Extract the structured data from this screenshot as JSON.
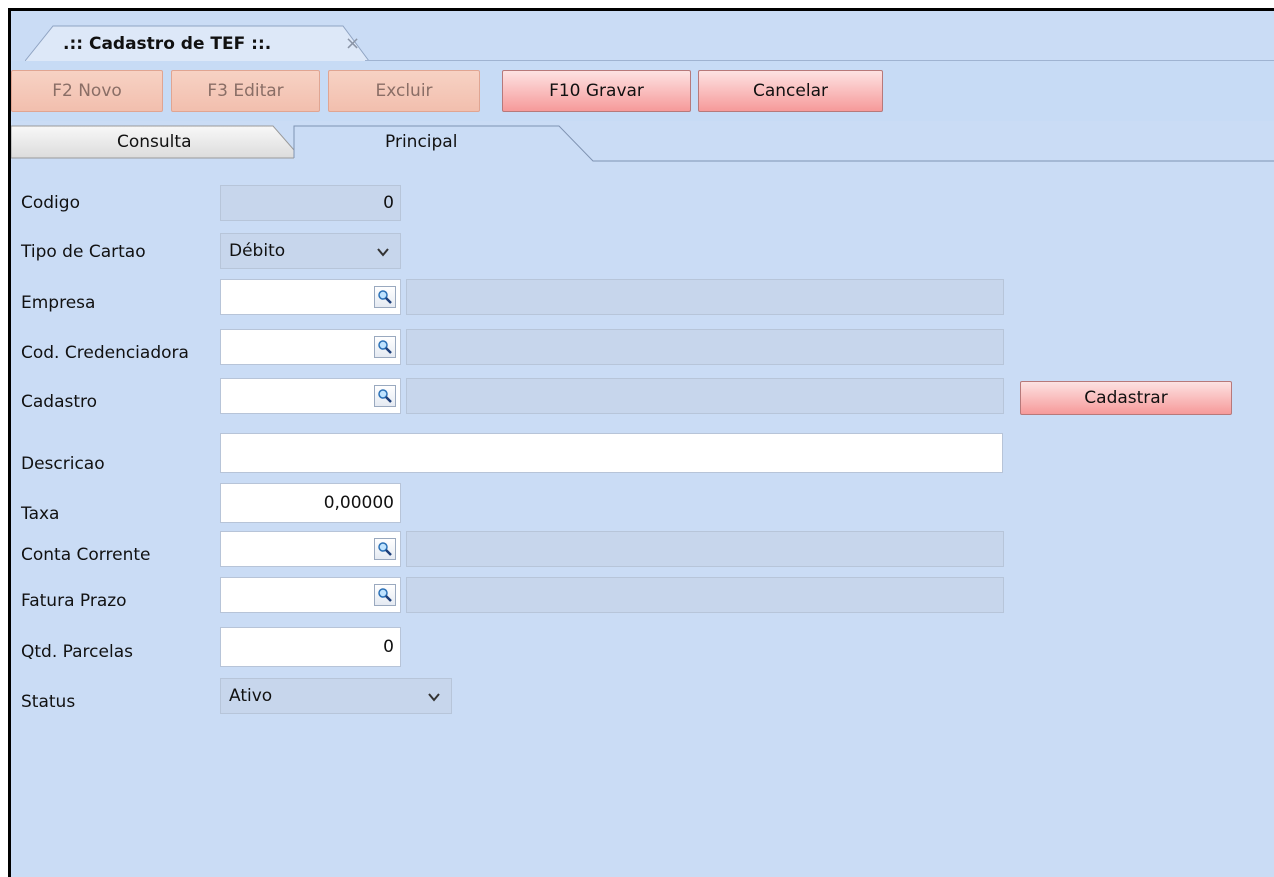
{
  "window": {
    "tab_title": ".:: Cadastro de TEF ::.",
    "close_glyph": "×"
  },
  "toolbar": {
    "new_label": "F2 Novo",
    "edit_label": "F3 Editar",
    "delete_label": "Excluir",
    "save_label": "F10 Gravar",
    "cancel_label": "Cancelar"
  },
  "tabs": {
    "consulta": "Consulta",
    "principal": "Principal",
    "active": "Principal"
  },
  "form": {
    "codigo": {
      "label": "Codigo",
      "value": "0"
    },
    "tipo_cartao": {
      "label": "Tipo de Cartao",
      "value": "Débito"
    },
    "empresa": {
      "label": "Empresa",
      "value": "",
      "description": ""
    },
    "cod_credenciadora": {
      "label": "Cod. Credenciadora",
      "value": "",
      "description": ""
    },
    "cadastro": {
      "label": "Cadastro",
      "value": "",
      "description": "",
      "button_label": "Cadastrar"
    },
    "descricao": {
      "label": "Descricao",
      "value": ""
    },
    "taxa": {
      "label": "Taxa",
      "value": "0,00000"
    },
    "conta_corrente": {
      "label": "Conta Corrente",
      "value": "",
      "description": ""
    },
    "fatura_prazo": {
      "label": "Fatura Prazo",
      "value": "",
      "description": ""
    },
    "qtd_parcelas": {
      "label": "Qtd. Parcelas",
      "value": "0"
    },
    "status": {
      "label": "Status",
      "value": "Ativo"
    }
  },
  "icons": {
    "lookup": "magnifier-icon",
    "dropdown": "chevron-down-icon"
  },
  "colors": {
    "background": "#cadcf5",
    "button_active": "#f69a9a",
    "button_disabled": "#f2bfae"
  }
}
